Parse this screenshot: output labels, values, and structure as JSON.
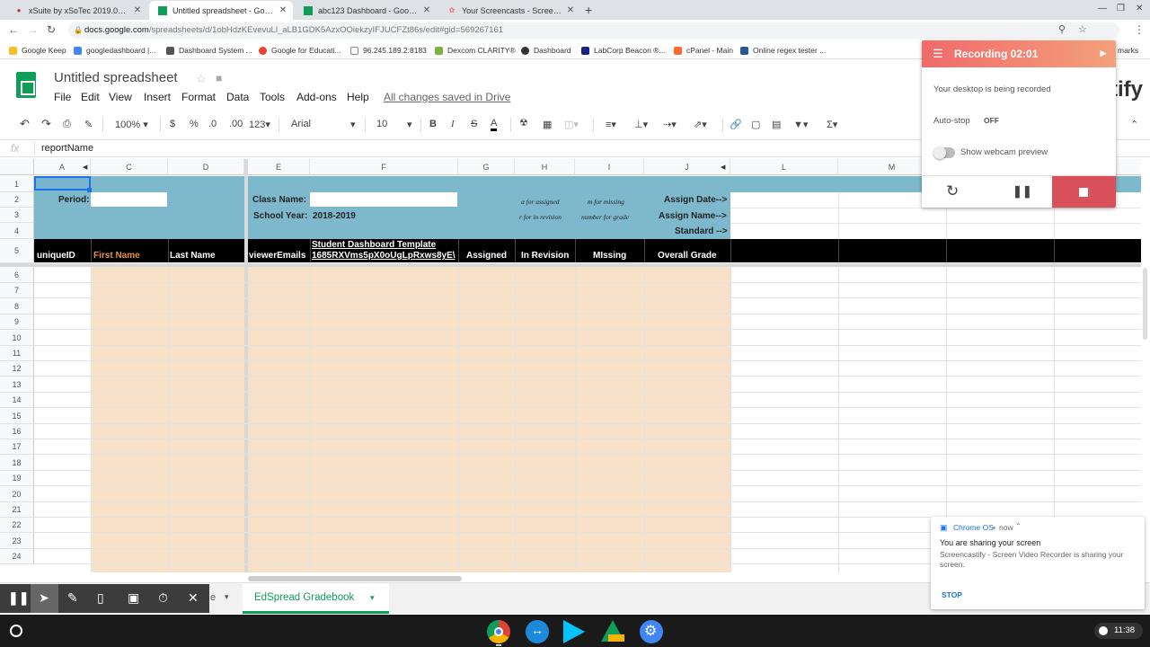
{
  "browser": {
    "tabs": [
      {
        "title": "xSuite by xSoTec 2019.02.22.2"
      },
      {
        "title": "Untitled spreadsheet - Google Sh"
      },
      {
        "title": "abc123 Dashboard - Google Sh"
      },
      {
        "title": "Your Screencasts - Screencastify"
      }
    ],
    "url_host": "docs.google.com",
    "url_path": "/spreadsheets/d/1obHdzKEvevuLl_aLB1GDK5AzxOOiekzyIFJUCFZt86s/edit#gid=569267161",
    "bookmarks": [
      "Google Keep",
      "googledashboard |...",
      "Dashboard System ...",
      "Google for Educati...",
      "96.245.189.2:8183",
      "Dexcom CLARITY®",
      "Dashboard",
      "LabCorp Beacon ®...",
      "cPanel - Main",
      "Online regex tester ..."
    ],
    "bookmarks_overflow": "marks"
  },
  "sheets": {
    "doc_title": "Untitled spreadsheet",
    "menu": [
      "File",
      "Edit",
      "View",
      "Insert",
      "Format",
      "Data",
      "Tools",
      "Add-ons",
      "Help"
    ],
    "saved_status": "All changes saved in Drive",
    "toolbar": {
      "zoom": "100%",
      "currency": "$",
      "percent": "%",
      "dec_less": ".0",
      "dec_more": ".00",
      "format_more": "123",
      "font": "Arial",
      "font_size": "10"
    },
    "formula_bar": {
      "fx": "fx",
      "value": "reportName"
    },
    "columns": [
      "A",
      "C",
      "D",
      "E",
      "F",
      "G",
      "H",
      "I",
      "J",
      "L",
      "M"
    ],
    "rows": [
      "1",
      "2",
      "3",
      "4",
      "5",
      "6",
      "7",
      "8",
      "9",
      "10",
      "11",
      "12",
      "13",
      "14",
      "15",
      "16",
      "17",
      "18",
      "19",
      "20",
      "21",
      "22",
      "23",
      "24"
    ],
    "cells": {
      "period": "Period:",
      "class_name": "Class Name:",
      "school_year": "School Year:",
      "school_year_val": "2018-2019",
      "note_a": "a for assigned",
      "note_r": "r for in revision",
      "note_m": "m for missing",
      "note_num": "number for grade",
      "assign_date": "Assign Date-->",
      "assign_name": "Assign Name-->",
      "standard": "Standard -->"
    },
    "headers": {
      "unique_id": "uniqueID",
      "first_name": "First Name",
      "last_name": "Last Name",
      "viewer_emails": "viewerEmails",
      "template_1": "Student Dashboard Template",
      "template_2": "1685RXVms5pX0oUgLpRxws8yE\\",
      "assigned": "Assigned",
      "in_revision": "In Revision",
      "missing": "MIssing",
      "overall": "Overall Grade"
    },
    "sheet_tab": "EdSpread Gradebook",
    "hidden_tab_frag": "e",
    "brand_frag": "tify"
  },
  "recorder": {
    "title": "Recording 02:01",
    "status": "Your desktop is being recorded",
    "autostop_label": "Auto-stop",
    "autostop_val": "OFF",
    "webcam_label": "Show webcam preview"
  },
  "notification": {
    "source": "Chrome OS",
    "time": "now",
    "title": "You are sharing your screen",
    "body": "Screencastify - Screen Video Recorder is sharing your screen.",
    "action": "STOP"
  },
  "shelf": {
    "time": "11:38"
  },
  "colors": {
    "header_blue": "#7db8cc",
    "peach": "#f7e1c8",
    "black_row": "#000000",
    "orange_text": "#e69138",
    "rec_red": "#d7505a",
    "sheets_green": "#0f9d58"
  }
}
